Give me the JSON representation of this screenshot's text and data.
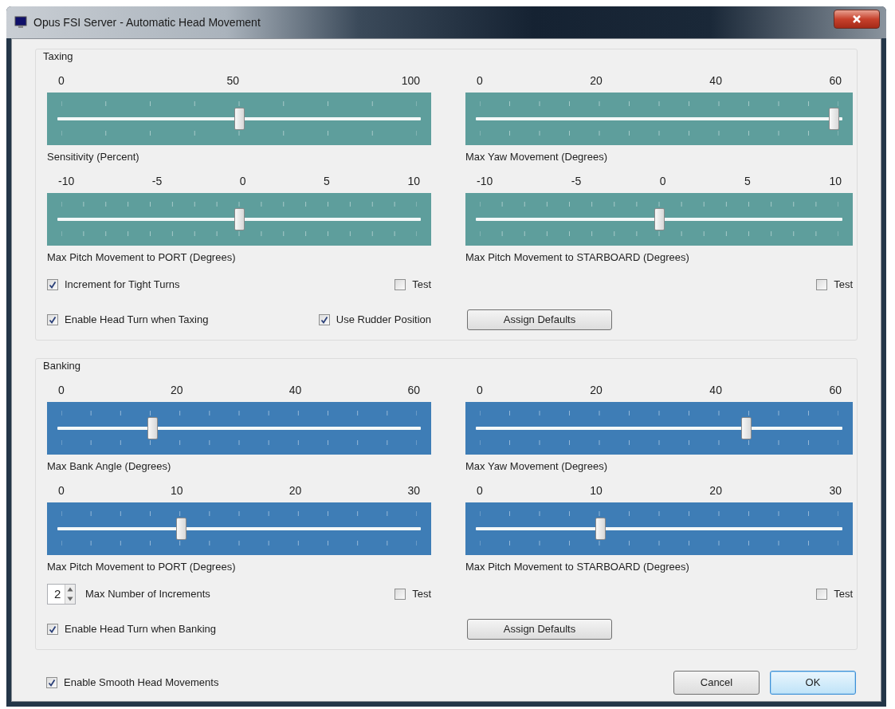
{
  "window": {
    "title": "Opus FSI Server - Automatic Head Movement"
  },
  "groups": [
    {
      "title": "Taxing",
      "color": "#5e9e9c",
      "sliders": [
        {
          "scale": [
            "0",
            "50",
            "100"
          ],
          "level": 0.5,
          "caption": "Sensitivity (Percent)"
        },
        {
          "scale": [
            "0",
            "20",
            "40",
            "60"
          ],
          "level": 1,
          "caption": "Max Yaw Movement (Degrees)"
        },
        {
          "scale": [
            "-10",
            "-5",
            "0",
            "5",
            "10"
          ],
          "level": 0.5,
          "caption": "Max Pitch Movement to PORT (Degrees)"
        },
        {
          "scale": [
            "-10",
            "-5",
            "0",
            "5",
            "10"
          ],
          "level": 0.5,
          "caption": "Max Pitch Movement to STARBOARD (Degrees)"
        }
      ],
      "rows": [
        {
          "left": {
            "start": [
              {
                "kind": "checkbox",
                "label": "Increment for Tight Turns",
                "checked": true
              }
            ],
            "end": [
              {
                "kind": "checkbox",
                "label": "Test",
                "checked": false
              }
            ]
          },
          "right": {
            "end": [
              {
                "kind": "checkbox",
                "label": "Test",
                "checked": false
              }
            ]
          }
        },
        {
          "left": {
            "start": [
              {
                "kind": "checkbox",
                "label": "Enable Head Turn when Taxing",
                "checked": true
              }
            ],
            "end": [
              {
                "kind": "checkbox",
                "label": "Use Rudder Position",
                "checked": true
              }
            ]
          },
          "right": {
            "start": [
              {
                "kind": "button",
                "label": "Assign Defaults"
              }
            ]
          }
        }
      ]
    },
    {
      "title": "Banking",
      "color": "#3e7db6",
      "sliders": [
        {
          "scale": [
            "0",
            "20",
            "40",
            "60"
          ],
          "level": 0.25,
          "caption": "Max Bank Angle (Degrees)"
        },
        {
          "scale": [
            "0",
            "20",
            "40",
            "60"
          ],
          "level": 0.75,
          "caption": "Max Yaw Movement (Degrees)"
        },
        {
          "scale": [
            "0",
            "10",
            "20",
            "30"
          ],
          "level": 0.3333,
          "caption": "Max Pitch Movement to PORT (Degrees)"
        },
        {
          "scale": [
            "0",
            "10",
            "20",
            "30"
          ],
          "level": 0.3333,
          "caption": "Max Pitch Movement to STARBOARD (Degrees)"
        }
      ],
      "rows": [
        {
          "left": {
            "start": [
              {
                "kind": "spinner",
                "value": "2",
                "label": "Max Number of Increments"
              }
            ],
            "end": [
              {
                "kind": "checkbox",
                "label": "Test",
                "checked": false
              }
            ]
          },
          "right": {
            "end": [
              {
                "kind": "checkbox",
                "label": "Test",
                "checked": false
              }
            ]
          }
        },
        {
          "left": {
            "start": [
              {
                "kind": "checkbox",
                "label": "Enable Head Turn when Banking",
                "checked": true
              }
            ]
          },
          "right": {
            "start": [
              {
                "kind": "button",
                "label": "Assign Defaults"
              }
            ]
          }
        }
      ]
    }
  ],
  "footer": {
    "checkbox": {
      "label": "Enable Smooth Head Movements",
      "checked": true
    },
    "buttons": [
      {
        "label": "Cancel",
        "default": false
      },
      {
        "label": "OK",
        "default": true
      }
    ]
  }
}
